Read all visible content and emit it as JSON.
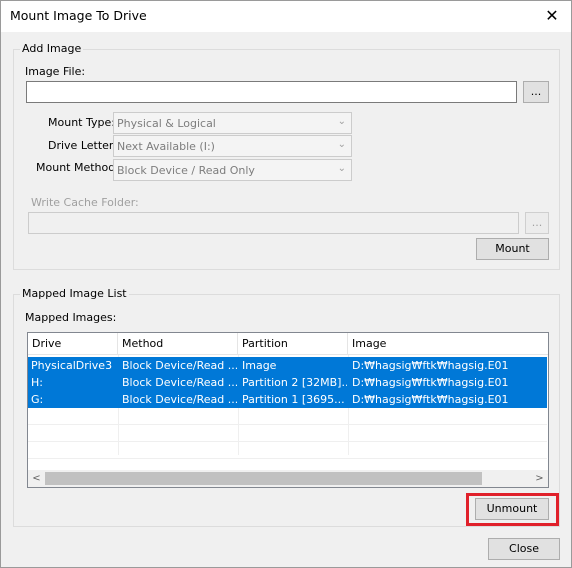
{
  "window": {
    "title": "Mount Image To Drive",
    "close_glyph": "✕"
  },
  "add_image": {
    "group_label": "Add Image",
    "image_file_label": "Image File:",
    "image_file_value": "",
    "browse_label": "...",
    "mount_type_label": "Mount Type:",
    "mount_type_value": "Physical & Logical",
    "drive_letter_label": "Drive Letter:",
    "drive_letter_value": "Next Available (I:)",
    "mount_method_label": "Mount Method:",
    "mount_method_value": "Block Device / Read Only",
    "write_cache_label": "Write Cache Folder:",
    "write_cache_value": "",
    "cache_browse_label": "...",
    "mount_button": "Mount"
  },
  "mapped": {
    "group_label": "Mapped Image List",
    "images_label": "Mapped Images:",
    "columns": [
      "Drive",
      "Method",
      "Partition",
      "Image"
    ],
    "rows": [
      {
        "drive": "PhysicalDrive3",
        "method": "Block Device/Read ...",
        "partition": "Image",
        "image": "D:₩hagsig₩ftk₩hagsig.E01"
      },
      {
        "drive": "H:",
        "method": "Block Device/Read ...",
        "partition": "Partition 2 [32MB]...",
        "image": "D:₩hagsig₩ftk₩hagsig.E01"
      },
      {
        "drive": "G:",
        "method": "Block Device/Read ...",
        "partition": "Partition 1 [3695...",
        "image": "D:₩hagsig₩ftk₩hagsig.E01"
      }
    ],
    "scroll_left": "<",
    "scroll_right": ">",
    "unmount_button": "Unmount"
  },
  "close_button": "Close",
  "colors": {
    "selection": "#0078d7",
    "highlight_box": "#e0202a"
  }
}
